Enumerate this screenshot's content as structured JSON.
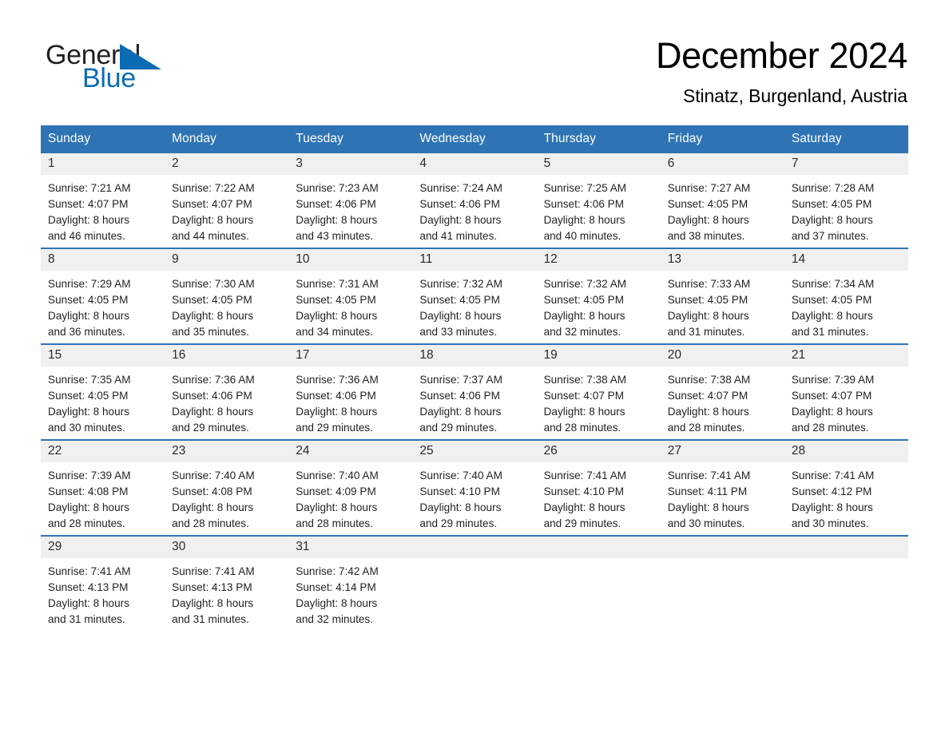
{
  "brand": {
    "name_part1": "General",
    "name_part2": "Blue",
    "logo_triangle": "triangle-icon",
    "blue": "#0b6cb5"
  },
  "header": {
    "month_title": "December 2024",
    "location": "Stinatz, Burgenland, Austria"
  },
  "theme": {
    "header_blue": "#2e74b5",
    "daynum_gray": "#f0f0f0",
    "text": "#231f20"
  },
  "weekday_headers": [
    "Sunday",
    "Monday",
    "Tuesday",
    "Wednesday",
    "Thursday",
    "Friday",
    "Saturday"
  ],
  "weeks": [
    [
      {
        "day": "1",
        "sunrise": "Sunrise: 7:21 AM",
        "sunset": "Sunset: 4:07 PM",
        "daylight_1": "Daylight: 8 hours",
        "daylight_2": "and 46 minutes."
      },
      {
        "day": "2",
        "sunrise": "Sunrise: 7:22 AM",
        "sunset": "Sunset: 4:07 PM",
        "daylight_1": "Daylight: 8 hours",
        "daylight_2": "and 44 minutes."
      },
      {
        "day": "3",
        "sunrise": "Sunrise: 7:23 AM",
        "sunset": "Sunset: 4:06 PM",
        "daylight_1": "Daylight: 8 hours",
        "daylight_2": "and 43 minutes."
      },
      {
        "day": "4",
        "sunrise": "Sunrise: 7:24 AM",
        "sunset": "Sunset: 4:06 PM",
        "daylight_1": "Daylight: 8 hours",
        "daylight_2": "and 41 minutes."
      },
      {
        "day": "5",
        "sunrise": "Sunrise: 7:25 AM",
        "sunset": "Sunset: 4:06 PM",
        "daylight_1": "Daylight: 8 hours",
        "daylight_2": "and 40 minutes."
      },
      {
        "day": "6",
        "sunrise": "Sunrise: 7:27 AM",
        "sunset": "Sunset: 4:05 PM",
        "daylight_1": "Daylight: 8 hours",
        "daylight_2": "and 38 minutes."
      },
      {
        "day": "7",
        "sunrise": "Sunrise: 7:28 AM",
        "sunset": "Sunset: 4:05 PM",
        "daylight_1": "Daylight: 8 hours",
        "daylight_2": "and 37 minutes."
      }
    ],
    [
      {
        "day": "8",
        "sunrise": "Sunrise: 7:29 AM",
        "sunset": "Sunset: 4:05 PM",
        "daylight_1": "Daylight: 8 hours",
        "daylight_2": "and 36 minutes."
      },
      {
        "day": "9",
        "sunrise": "Sunrise: 7:30 AM",
        "sunset": "Sunset: 4:05 PM",
        "daylight_1": "Daylight: 8 hours",
        "daylight_2": "and 35 minutes."
      },
      {
        "day": "10",
        "sunrise": "Sunrise: 7:31 AM",
        "sunset": "Sunset: 4:05 PM",
        "daylight_1": "Daylight: 8 hours",
        "daylight_2": "and 34 minutes."
      },
      {
        "day": "11",
        "sunrise": "Sunrise: 7:32 AM",
        "sunset": "Sunset: 4:05 PM",
        "daylight_1": "Daylight: 8 hours",
        "daylight_2": "and 33 minutes."
      },
      {
        "day": "12",
        "sunrise": "Sunrise: 7:32 AM",
        "sunset": "Sunset: 4:05 PM",
        "daylight_1": "Daylight: 8 hours",
        "daylight_2": "and 32 minutes."
      },
      {
        "day": "13",
        "sunrise": "Sunrise: 7:33 AM",
        "sunset": "Sunset: 4:05 PM",
        "daylight_1": "Daylight: 8 hours",
        "daylight_2": "and 31 minutes."
      },
      {
        "day": "14",
        "sunrise": "Sunrise: 7:34 AM",
        "sunset": "Sunset: 4:05 PM",
        "daylight_1": "Daylight: 8 hours",
        "daylight_2": "and 31 minutes."
      }
    ],
    [
      {
        "day": "15",
        "sunrise": "Sunrise: 7:35 AM",
        "sunset": "Sunset: 4:05 PM",
        "daylight_1": "Daylight: 8 hours",
        "daylight_2": "and 30 minutes."
      },
      {
        "day": "16",
        "sunrise": "Sunrise: 7:36 AM",
        "sunset": "Sunset: 4:06 PM",
        "daylight_1": "Daylight: 8 hours",
        "daylight_2": "and 29 minutes."
      },
      {
        "day": "17",
        "sunrise": "Sunrise: 7:36 AM",
        "sunset": "Sunset: 4:06 PM",
        "daylight_1": "Daylight: 8 hours",
        "daylight_2": "and 29 minutes."
      },
      {
        "day": "18",
        "sunrise": "Sunrise: 7:37 AM",
        "sunset": "Sunset: 4:06 PM",
        "daylight_1": "Daylight: 8 hours",
        "daylight_2": "and 29 minutes."
      },
      {
        "day": "19",
        "sunrise": "Sunrise: 7:38 AM",
        "sunset": "Sunset: 4:07 PM",
        "daylight_1": "Daylight: 8 hours",
        "daylight_2": "and 28 minutes."
      },
      {
        "day": "20",
        "sunrise": "Sunrise: 7:38 AM",
        "sunset": "Sunset: 4:07 PM",
        "daylight_1": "Daylight: 8 hours",
        "daylight_2": "and 28 minutes."
      },
      {
        "day": "21",
        "sunrise": "Sunrise: 7:39 AM",
        "sunset": "Sunset: 4:07 PM",
        "daylight_1": "Daylight: 8 hours",
        "daylight_2": "and 28 minutes."
      }
    ],
    [
      {
        "day": "22",
        "sunrise": "Sunrise: 7:39 AM",
        "sunset": "Sunset: 4:08 PM",
        "daylight_1": "Daylight: 8 hours",
        "daylight_2": "and 28 minutes."
      },
      {
        "day": "23",
        "sunrise": "Sunrise: 7:40 AM",
        "sunset": "Sunset: 4:08 PM",
        "daylight_1": "Daylight: 8 hours",
        "daylight_2": "and 28 minutes."
      },
      {
        "day": "24",
        "sunrise": "Sunrise: 7:40 AM",
        "sunset": "Sunset: 4:09 PM",
        "daylight_1": "Daylight: 8 hours",
        "daylight_2": "and 28 minutes."
      },
      {
        "day": "25",
        "sunrise": "Sunrise: 7:40 AM",
        "sunset": "Sunset: 4:10 PM",
        "daylight_1": "Daylight: 8 hours",
        "daylight_2": "and 29 minutes."
      },
      {
        "day": "26",
        "sunrise": "Sunrise: 7:41 AM",
        "sunset": "Sunset: 4:10 PM",
        "daylight_1": "Daylight: 8 hours",
        "daylight_2": "and 29 minutes."
      },
      {
        "day": "27",
        "sunrise": "Sunrise: 7:41 AM",
        "sunset": "Sunset: 4:11 PM",
        "daylight_1": "Daylight: 8 hours",
        "daylight_2": "and 30 minutes."
      },
      {
        "day": "28",
        "sunrise": "Sunrise: 7:41 AM",
        "sunset": "Sunset: 4:12 PM",
        "daylight_1": "Daylight: 8 hours",
        "daylight_2": "and 30 minutes."
      }
    ],
    [
      {
        "day": "29",
        "sunrise": "Sunrise: 7:41 AM",
        "sunset": "Sunset: 4:13 PM",
        "daylight_1": "Daylight: 8 hours",
        "daylight_2": "and 31 minutes."
      },
      {
        "day": "30",
        "sunrise": "Sunrise: 7:41 AM",
        "sunset": "Sunset: 4:13 PM",
        "daylight_1": "Daylight: 8 hours",
        "daylight_2": "and 31 minutes."
      },
      {
        "day": "31",
        "sunrise": "Sunrise: 7:42 AM",
        "sunset": "Sunset: 4:14 PM",
        "daylight_1": "Daylight: 8 hours",
        "daylight_2": "and 32 minutes."
      },
      {
        "day": "",
        "sunrise": "",
        "sunset": "",
        "daylight_1": "",
        "daylight_2": ""
      },
      {
        "day": "",
        "sunrise": "",
        "sunset": "",
        "daylight_1": "",
        "daylight_2": ""
      },
      {
        "day": "",
        "sunrise": "",
        "sunset": "",
        "daylight_1": "",
        "daylight_2": ""
      },
      {
        "day": "",
        "sunrise": "",
        "sunset": "",
        "daylight_1": "",
        "daylight_2": ""
      }
    ]
  ]
}
